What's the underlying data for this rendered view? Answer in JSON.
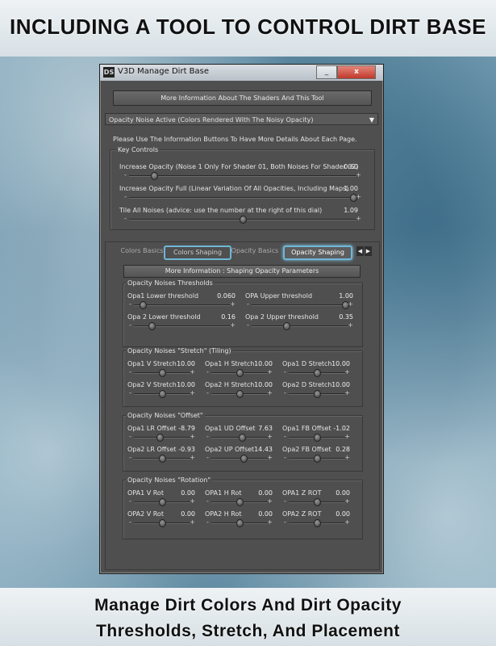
{
  "banner_top": "INCLUDING A TOOL TO CONTROL DIRT BASE",
  "banner_bottom": [
    "Manage Dirt Colors And Dirt Opacity",
    "Thresholds, Stretch, And Placement"
  ],
  "window": {
    "icon": "DS",
    "title": "V3D Manage Dirt Base",
    "minimize": "_",
    "close": "x"
  },
  "info_button": "More Information About The Shaders And This Tool",
  "dropdown": "Opacity Noise Active (Colors Rendered With The Noisy Opacity)",
  "hint": "Please Use The Information Buttons To Have More Details About Each Page.",
  "key_controls": {
    "title": "Key Controls",
    "sliders": [
      {
        "label": "Increase Opacity (Noise 1 Only For Shader 01, Both Noises For Shader 02)",
        "value": "0.60",
        "level": 0.1
      },
      {
        "label": "Increase Opacity Full (Linear Variation Of All Opacities, Including Maps)",
        "value": "1.00",
        "level": 1.0
      },
      {
        "label": "Tile All Noises (advice: use the number at the right of this dial)",
        "value": "1.09",
        "level": 0.5
      }
    ]
  },
  "tabs": [
    {
      "label": "Colors Basics",
      "state": "normal"
    },
    {
      "label": "Colors Shaping",
      "state": "highlighted"
    },
    {
      "label": "Opacity Basics",
      "state": "normal"
    },
    {
      "label": "Opacity Shaping",
      "state": "active"
    }
  ],
  "tab_nav": {
    "prev": "◀",
    "next": "▶"
  },
  "shaping_info_button": "More Information : Shaping Opacity Parameters",
  "thresholds": {
    "title": "Opacity Noises Thresholds",
    "rows": [
      [
        {
          "label": "Opa1 Lower threshold",
          "value": "0.060",
          "level": 0.06
        },
        {
          "label": "OPA Upper threshold",
          "value": "1.00",
          "level": 1.0
        }
      ],
      [
        {
          "label": "Opa 2 Lower threshold",
          "value": "0.16",
          "level": 0.16
        },
        {
          "label": "Opa 2 Upper threshold",
          "value": "0.35",
          "level": 0.35
        }
      ]
    ]
  },
  "stretch": {
    "title": "Opacity Noises \"Stretch\" (Tiling)",
    "rows": [
      [
        {
          "label": "Opa1 V Stretch",
          "value": "10.00",
          "level": 0.5
        },
        {
          "label": "Opa1 H Stretch",
          "value": "10.00",
          "level": 0.5
        },
        {
          "label": "Opa1 D Stretch",
          "value": "10.00",
          "level": 0.5
        }
      ],
      [
        {
          "label": "Opa2 V Stretch",
          "value": "10.00",
          "level": 0.5
        },
        {
          "label": "Opa2 H Stretch",
          "value": "10.00",
          "level": 0.5
        },
        {
          "label": "Opa2 D Stretch",
          "value": "10.00",
          "level": 0.5
        }
      ]
    ]
  },
  "offset": {
    "title": "Opacity Noises \"Offset\"",
    "rows": [
      [
        {
          "label": "Opa1 LR Offset",
          "value": "-8.79",
          "level": 0.45
        },
        {
          "label": "Opa1 UD Offset",
          "value": "7.63",
          "level": 0.55
        },
        {
          "label": "Opa1 FB Offset",
          "value": "-1.02",
          "level": 0.5
        }
      ],
      [
        {
          "label": "Opa2 LR Offset",
          "value": "-0.93",
          "level": 0.5
        },
        {
          "label": "Opa2 UP Offset",
          "value": "14.43",
          "level": 0.58
        },
        {
          "label": "Opa2 FB Offset",
          "value": "0.28",
          "level": 0.5
        }
      ]
    ]
  },
  "rotation": {
    "title": "Opacity Noises \"Rotation\"",
    "rows": [
      [
        {
          "label": "OPA1 V Rot",
          "value": "0.00",
          "level": 0.5
        },
        {
          "label": "OPA1 H Rot",
          "value": "0.00",
          "level": 0.5
        },
        {
          "label": "OPA1 Z ROT",
          "value": "0.00",
          "level": 0.5
        }
      ],
      [
        {
          "label": "OPA2 V Rot",
          "value": "0.00",
          "level": 0.5
        },
        {
          "label": "OPA2 H Rot",
          "value": "0.00",
          "level": 0.5
        },
        {
          "label": "OPA2 Z ROT",
          "value": "0.00",
          "level": 0.5
        }
      ]
    ]
  }
}
